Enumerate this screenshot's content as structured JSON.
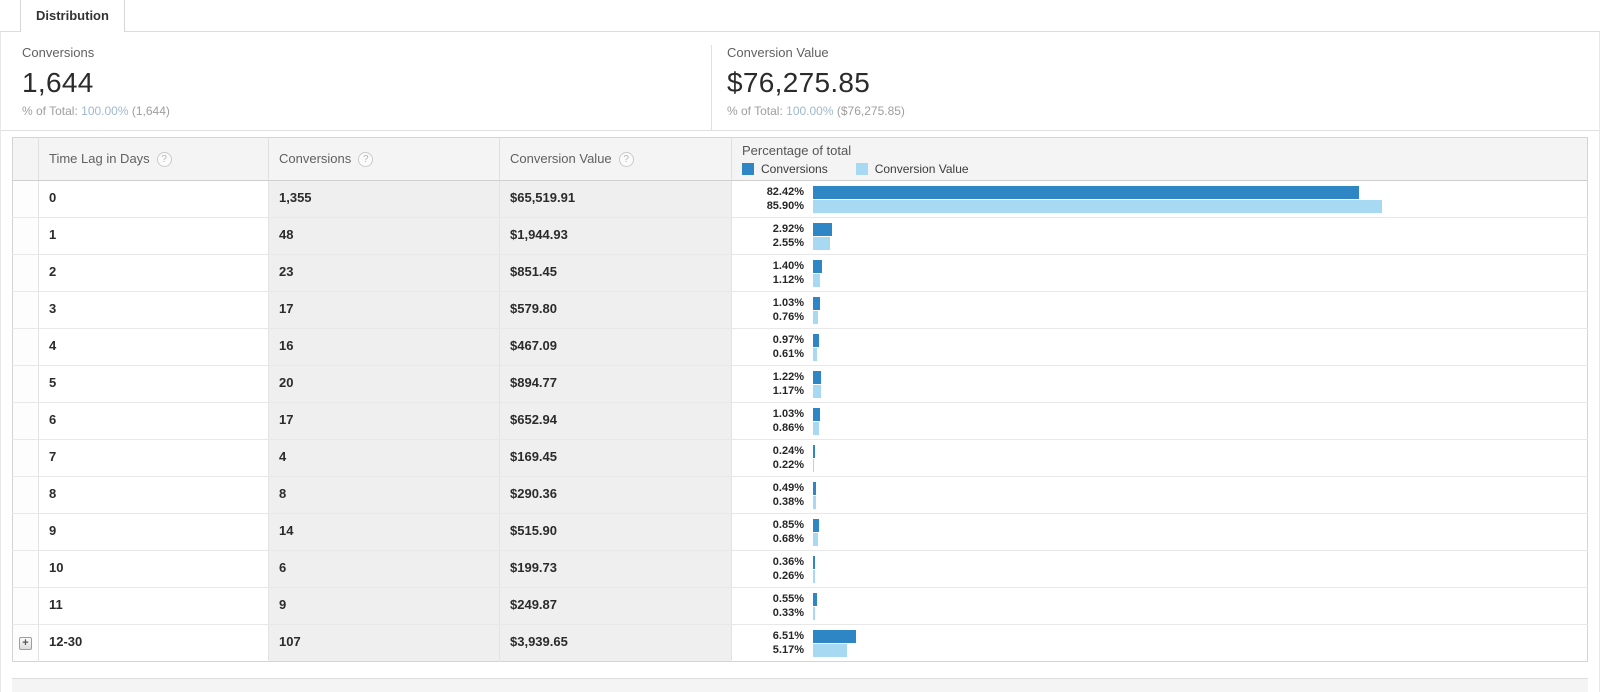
{
  "tab": {
    "label": "Distribution"
  },
  "summary": {
    "conversions": {
      "label": "Conversions",
      "value": "1,644",
      "pct_prefix": "% of Total:",
      "pct_value": "100.00%",
      "pct_suffix": "(1,644)"
    },
    "conversion_value": {
      "label": "Conversion Value",
      "value": "$76,275.85",
      "pct_prefix": "% of Total:",
      "pct_value": "100.00%",
      "pct_suffix": "($76,275.85)"
    }
  },
  "table": {
    "headers": {
      "lag": "Time Lag in Days",
      "conversions": "Conversions",
      "value": "Conversion Value",
      "pct_title": "Percentage of total"
    },
    "legend": {
      "conversions": "Conversions",
      "conversion_value": "Conversion Value"
    },
    "help_glyph": "?",
    "expand_glyph": "+",
    "rows": [
      {
        "lag": "0",
        "conversions": "1,355",
        "value": "$65,519.91",
        "pct_conversions": "82.42%",
        "pct_value": "85.90%",
        "expandable": false
      },
      {
        "lag": "1",
        "conversions": "48",
        "value": "$1,944.93",
        "pct_conversions": "2.92%",
        "pct_value": "2.55%",
        "expandable": false
      },
      {
        "lag": "2",
        "conversions": "23",
        "value": "$851.45",
        "pct_conversions": "1.40%",
        "pct_value": "1.12%",
        "expandable": false
      },
      {
        "lag": "3",
        "conversions": "17",
        "value": "$579.80",
        "pct_conversions": "1.03%",
        "pct_value": "0.76%",
        "expandable": false
      },
      {
        "lag": "4",
        "conversions": "16",
        "value": "$467.09",
        "pct_conversions": "0.97%",
        "pct_value": "0.61%",
        "expandable": false
      },
      {
        "lag": "5",
        "conversions": "20",
        "value": "$894.77",
        "pct_conversions": "1.22%",
        "pct_value": "1.17%",
        "expandable": false
      },
      {
        "lag": "6",
        "conversions": "17",
        "value": "$652.94",
        "pct_conversions": "1.03%",
        "pct_value": "0.86%",
        "expandable": false
      },
      {
        "lag": "7",
        "conversions": "4",
        "value": "$169.45",
        "pct_conversions": "0.24%",
        "pct_value": "0.22%",
        "expandable": false
      },
      {
        "lag": "8",
        "conversions": "8",
        "value": "$290.36",
        "pct_conversions": "0.49%",
        "pct_value": "0.38%",
        "expandable": false
      },
      {
        "lag": "9",
        "conversions": "14",
        "value": "$515.90",
        "pct_conversions": "0.85%",
        "pct_value": "0.68%",
        "expandable": false
      },
      {
        "lag": "10",
        "conversions": "6",
        "value": "$199.73",
        "pct_conversions": "0.36%",
        "pct_value": "0.26%",
        "expandable": false
      },
      {
        "lag": "11",
        "conversions": "9",
        "value": "$249.87",
        "pct_conversions": "0.55%",
        "pct_value": "0.33%",
        "expandable": false
      },
      {
        "lag": "12-30",
        "conversions": "107",
        "value": "$3,939.65",
        "pct_conversions": "6.51%",
        "pct_value": "5.17%",
        "expandable": true
      }
    ]
  },
  "colors": {
    "bar_conversions": "#2e86c4",
    "bar_conversion_value": "#a8d9f2"
  }
}
